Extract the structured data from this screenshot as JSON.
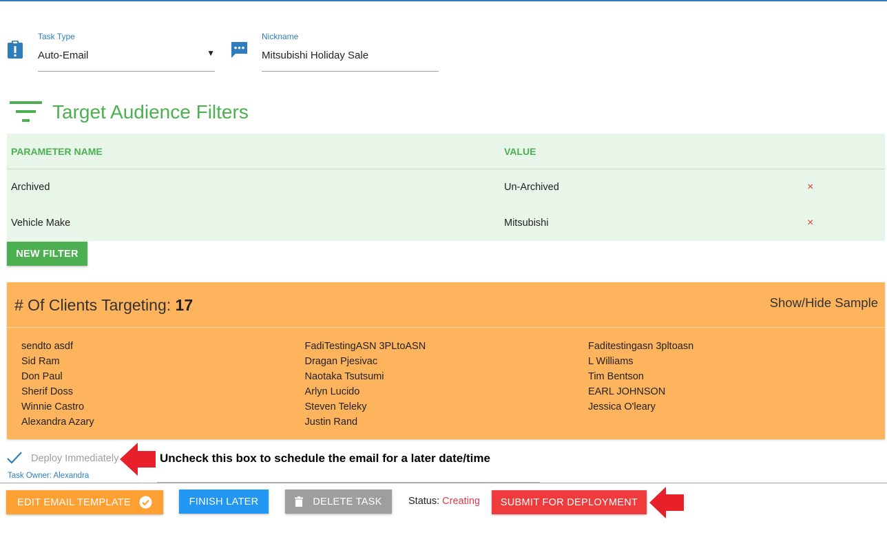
{
  "task_type": {
    "label": "Task Type",
    "value": "Auto-Email"
  },
  "nickname": {
    "label": "Nickname",
    "value": "Mitsubishi Holiday Sale"
  },
  "filters": {
    "title": "Target Audience Filters",
    "columns": {
      "name": "PARAMETER NAME",
      "value": "VALUE"
    },
    "rows": [
      {
        "name": "Archived",
        "value": "Un-Archived",
        "delete": "×"
      },
      {
        "name": "Vehicle Make",
        "value": "Mitsubishi",
        "delete": "×"
      }
    ],
    "new_filter_label": "NEW FILTER"
  },
  "clients": {
    "title": "# Of Clients Targeting: ",
    "count": "17",
    "toggle_label": "Show/Hide Sample",
    "columns": [
      [
        "sendto asdf",
        "Sid Ram",
        "Don Paul",
        "Sherif Doss",
        "Winnie Castro",
        "Alexandra Azary"
      ],
      [
        "FadiTestingASN 3PLtoASN",
        "Dragan Pjesivac",
        "Naotaka Tsutsumi",
        "Arlyn Lucido",
        "Steven Teleky",
        "Justin Rand"
      ],
      [
        "Faditestingasn 3pltoasn",
        "L Williams",
        "Tim Bentson",
        "EARL JOHNSON",
        "Jessica O'leary"
      ]
    ]
  },
  "deploy": {
    "label": "Deploy Immediately",
    "checked": true,
    "task_owner": "Task Owner: Alexandra",
    "annotation": "Uncheck this box to schedule the email for a later date/time"
  },
  "actions": {
    "edit_template": "EDIT EMAIL TEMPLATE",
    "finish_later": "FINISH LATER",
    "delete_task": "DELETE TASK",
    "status_label": "Status: ",
    "status_value": "Creating",
    "submit": "SUBMIT FOR DEPLOYMENT"
  },
  "colors": {
    "accent_blue": "#2f7dbd",
    "filter_green": "#4caf50",
    "clients_orange": "#fdb45c",
    "edit_orange": "#ffa032",
    "finish_blue": "#2196f3",
    "delete_grey": "#9e9e9e",
    "submit_red": "#ef3b3b",
    "annotation_red": "#e8202a"
  }
}
